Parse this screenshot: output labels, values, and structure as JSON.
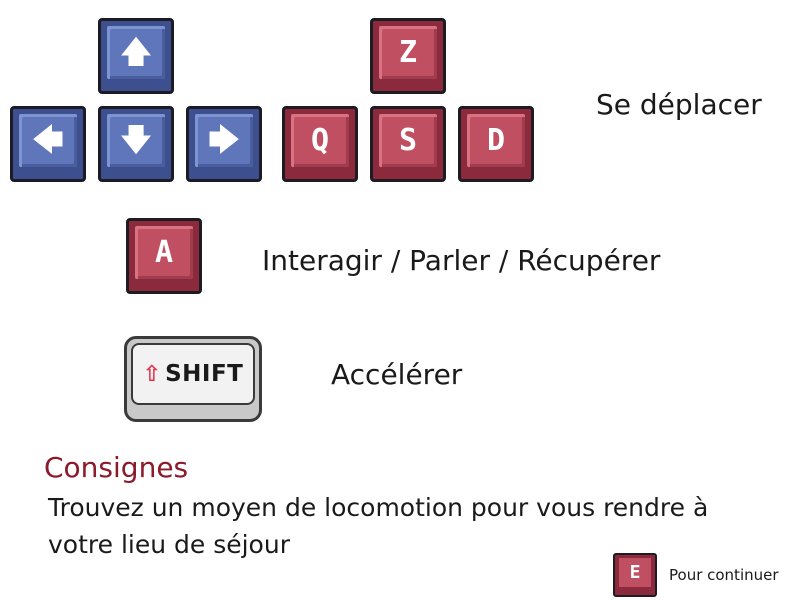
{
  "controls": {
    "arrow_keys": {
      "up": "🡅",
      "left": "🡄",
      "down": "🡇",
      "right": "🡆"
    },
    "letter_keys": {
      "z": "Z",
      "q": "Q",
      "s": "S",
      "d": "D"
    },
    "move_label": "Se déplacer",
    "interact_key": "A",
    "interact_label": "Interagir / Parler / Récupérer",
    "shift_key": "SHIFT",
    "shift_icon": "⇧",
    "sprint_label": "Accélérer"
  },
  "instructions": {
    "title": "Consignes",
    "line1": "Trouvez un moyen de locomotion pour vous rendre à",
    "line2": "votre lieu de séjour"
  },
  "continue_prompt": {
    "key": "E",
    "label": "Pour continuer"
  },
  "colors": {
    "blue_key": "#5f76bb",
    "red_key": "#c14f62",
    "title_color": "#8b1a2b"
  }
}
